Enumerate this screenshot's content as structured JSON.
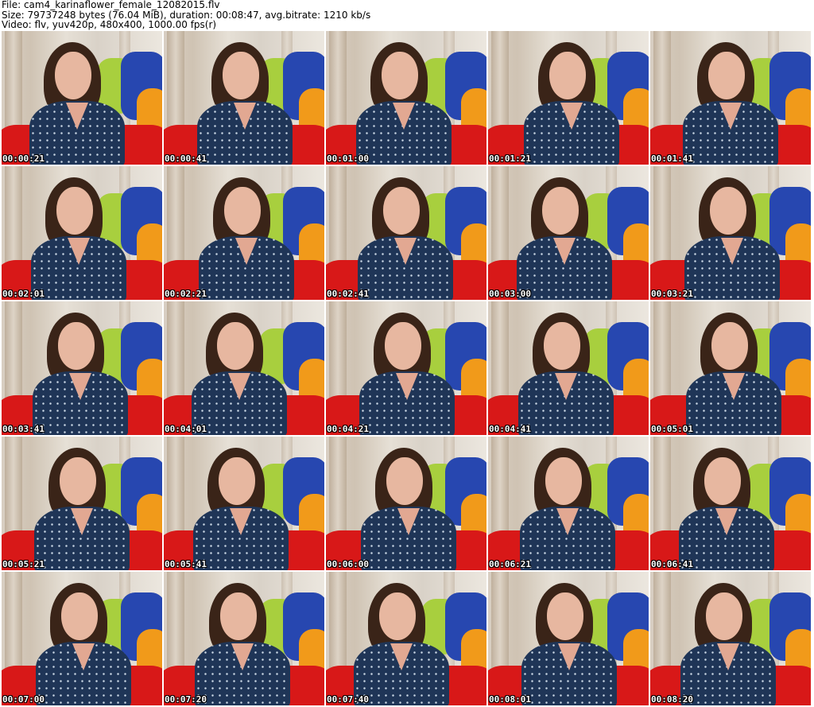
{
  "header": {
    "file_line": "File: cam4_karinaflower_female_12082015.flv",
    "size_line": "Size: 79737248 bytes (76.04 MiB), duration: 00:08:47, avg.bitrate: 1210 kb/s",
    "video_line": "Video: flv, yuv420p, 480x400, 1000.00 fps(r)"
  },
  "thumbnails": [
    "00:00:21",
    "00:00:41",
    "00:01:00",
    "00:01:21",
    "00:01:41",
    "00:02:01",
    "00:02:21",
    "00:02:41",
    "00:03:00",
    "00:03:21",
    "00:03:41",
    "00:04:01",
    "00:04:21",
    "00:04:41",
    "00:05:01",
    "00:05:21",
    "00:05:41",
    "00:06:00",
    "00:06:21",
    "00:06:41",
    "00:07:00",
    "00:07:20",
    "00:07:40",
    "00:08:01",
    "00:08:20"
  ],
  "colors": {
    "background": "#ffffff",
    "shirt": "#1f3557",
    "hair": "#3a2418",
    "pillow_green": "#a8cf3e",
    "pillow_blue": "#2747b0",
    "pillow_orange": "#f19a1a",
    "pillow_red": "#d81818"
  }
}
